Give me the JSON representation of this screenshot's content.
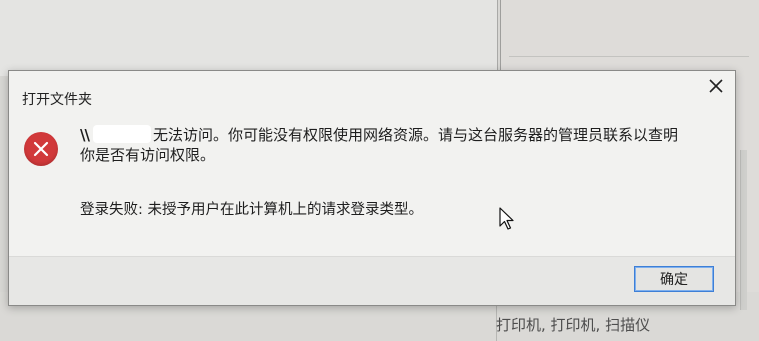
{
  "dialog": {
    "title": "打开文件夹",
    "path_prefix": "\\\\",
    "message_line1": "无法访问。你可能没有权限使用网络资源。请与这台服务器的管理员联系以查明",
    "message_line2": "你是否有访问权限。",
    "detail": "登录失败: 未授予用户在此计算机上的请求登录类型。",
    "ok_label": "确定",
    "icon": "error-icon",
    "close_icon": "close-icon"
  },
  "background": {
    "bottom_text": "打印机, 打印机, 扫描仪"
  },
  "colors": {
    "error_red": "#d1393a",
    "button_focus_border": "#3e7fd6"
  }
}
